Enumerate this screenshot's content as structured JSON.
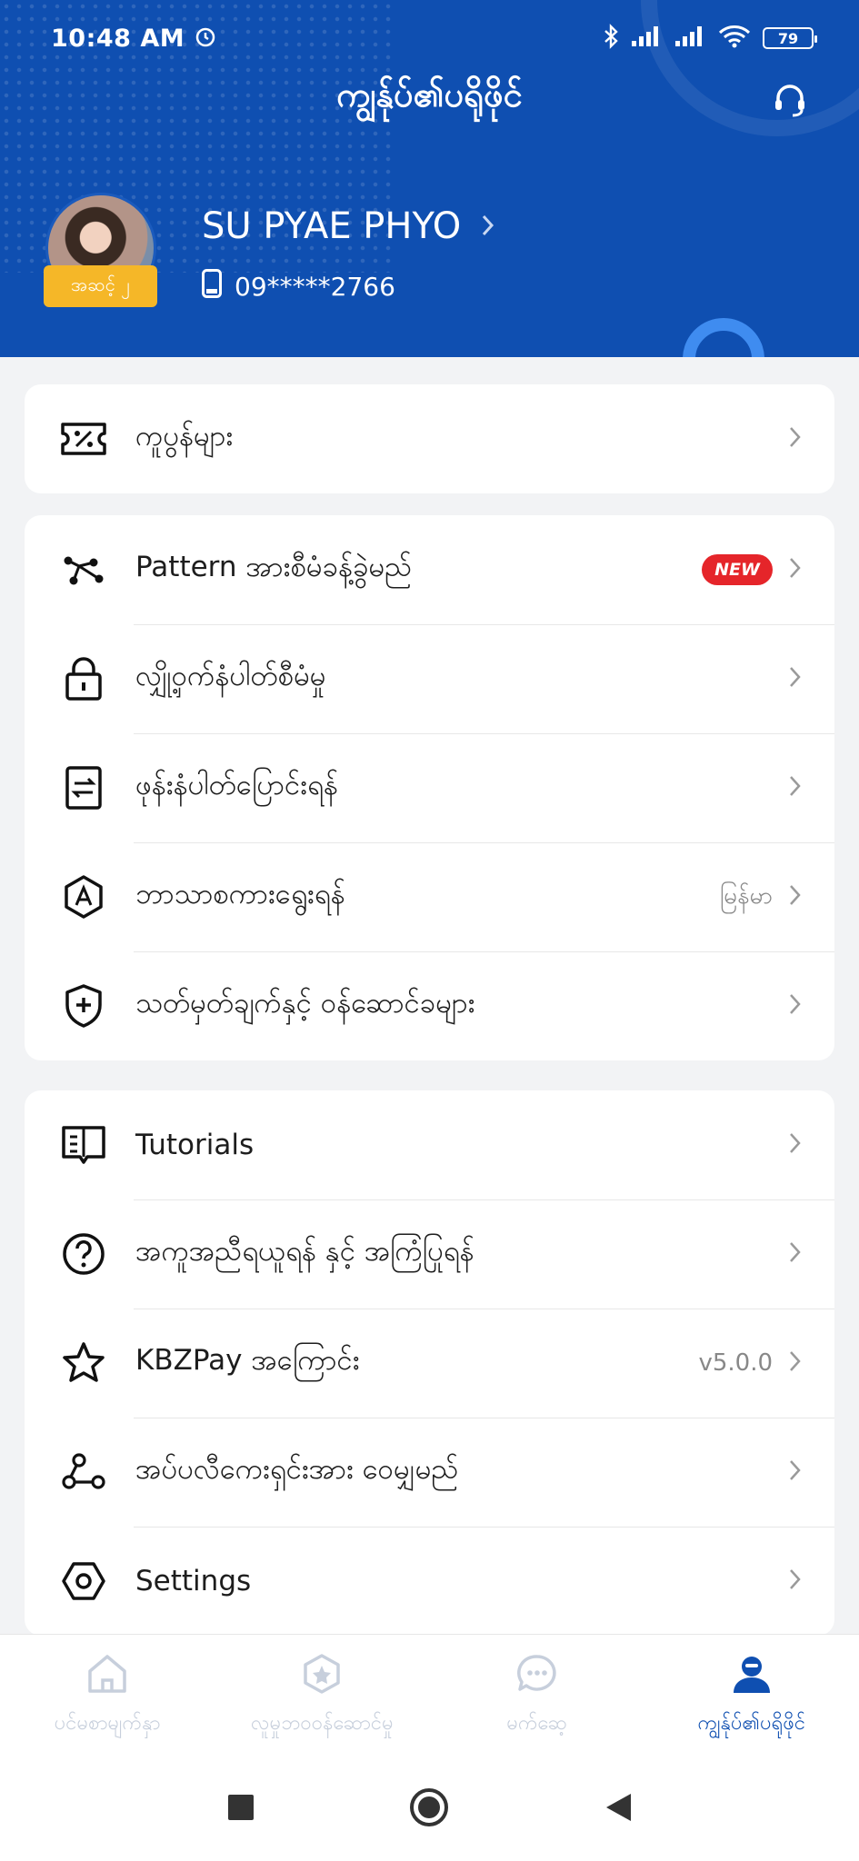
{
  "status_bar": {
    "time": "10:48 AM",
    "battery": "79"
  },
  "header": {
    "title": "ကျွန်ုပ်၏ပရိုဖိုင်"
  },
  "profile": {
    "name": "SU PYAE PHYO",
    "level": "အဆင့် ၂",
    "phone": "09*****2766"
  },
  "card1": {
    "items": [
      {
        "label": "ကူပွန်များ"
      }
    ]
  },
  "card2": {
    "items": [
      {
        "label": "Pattern အားစီမံခန့်ခွဲမည်",
        "badge": "NEW"
      },
      {
        "label": "လျှို့ဝှက်နံပါတ်စီမံမှု"
      },
      {
        "label": "ဖုန်းနံပါတ်ပြောင်းရန်"
      },
      {
        "label": "ဘာသာစကားရွေးရန်",
        "value": "မြန်မာ"
      },
      {
        "label": "သတ်မှတ်ချက်နှင့် ဝန်ဆောင်ခများ"
      }
    ]
  },
  "card3": {
    "items": [
      {
        "label": "Tutorials"
      },
      {
        "label": "အကူအညီရယူရန် နှင့် အကြံပြုရန်"
      },
      {
        "label": "KBZPay အကြောင်း",
        "value": "v5.0.0"
      },
      {
        "label": "အပ်ပလီကေးရှင်းအား ဝေမျှမည်"
      },
      {
        "label": "Settings"
      }
    ]
  },
  "bottom_nav": {
    "items": [
      {
        "label": "ပင်မစာမျက်နှာ",
        "icon": "home-icon"
      },
      {
        "label": "လူမှုဘဝဝန်ဆောင်မှု",
        "icon": "badge-icon"
      },
      {
        "label": "မက်ဆေ့",
        "icon": "chat-icon"
      },
      {
        "label": "ကျွန်ုပ်၏ပရိုဖိုင်",
        "icon": "person-icon",
        "active": true
      }
    ]
  },
  "colors": {
    "primary": "#0f4fb1",
    "badge_gold": "#f5b728",
    "new_red": "#e5252a"
  }
}
